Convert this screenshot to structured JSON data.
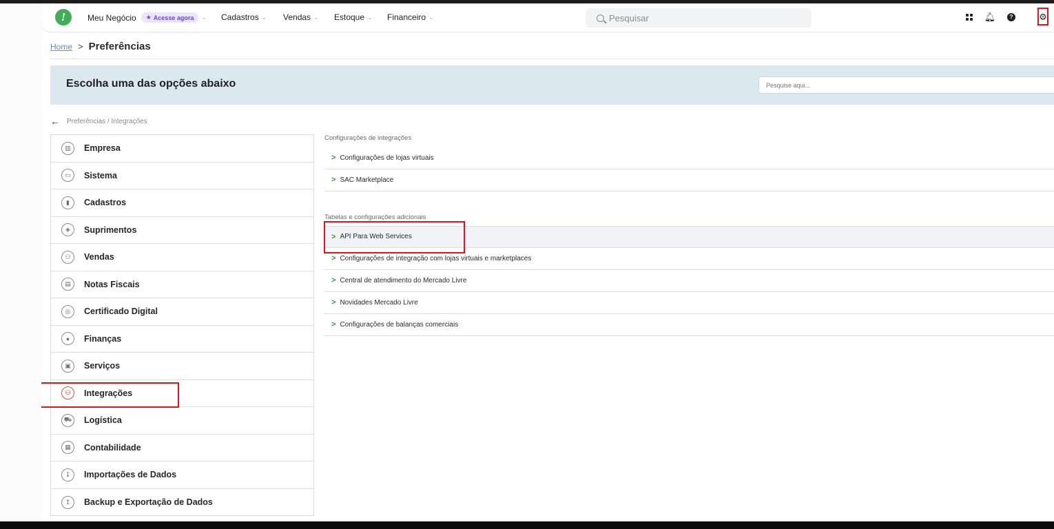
{
  "topnav": {
    "logo_glyph": "!",
    "items": [
      {
        "label": "Meu Negócio",
        "badge": "Acesse agora"
      },
      {
        "label": "Cadastros"
      },
      {
        "label": "Vendas"
      },
      {
        "label": "Estoque"
      },
      {
        "label": "Financeiro"
      }
    ],
    "search_placeholder": "Pesquisar",
    "icons": [
      "apps-icon",
      "bell-icon",
      "help-icon",
      "gear-icon"
    ]
  },
  "breadcrumb": {
    "home": "Home",
    "separator": ">",
    "current": "Preferências"
  },
  "banner": {
    "title": "Escolha uma das opções abaixo",
    "search_placeholder": "Pesquise aqui..."
  },
  "back": {
    "path": "Preferências / Integrações"
  },
  "menu": {
    "items": [
      {
        "label": "Empresa",
        "icon": "building-icon",
        "glyph": "▥"
      },
      {
        "label": "Sistema",
        "icon": "monitor-icon",
        "glyph": "▭"
      },
      {
        "label": "Cadastros",
        "icon": "book-icon",
        "glyph": "▮"
      },
      {
        "label": "Suprimentos",
        "icon": "box-icon",
        "glyph": "◈"
      },
      {
        "label": "Vendas",
        "icon": "people-icon",
        "glyph": "⚇"
      },
      {
        "label": "Notas Fiscais",
        "icon": "invoice-icon",
        "glyph": "▤"
      },
      {
        "label": "Certificado Digital",
        "icon": "certificate-icon",
        "glyph": "◎"
      },
      {
        "label": "Finanças",
        "icon": "piggy-bank-icon",
        "glyph": "●"
      },
      {
        "label": "Serviços",
        "icon": "clipboard-icon",
        "glyph": "▣"
      },
      {
        "label": "Integrações",
        "icon": "integration-icon",
        "glyph": "⛁",
        "active": true
      },
      {
        "label": "Logística",
        "icon": "truck-icon",
        "glyph": "⛟"
      },
      {
        "label": "Contabilidade",
        "icon": "calculator-icon",
        "glyph": "▦"
      },
      {
        "label": "Importações de Dados",
        "icon": "import-icon",
        "glyph": "↧"
      },
      {
        "label": "Backup e Exportação de Dados",
        "icon": "export-icon",
        "glyph": "↥"
      }
    ]
  },
  "sections": {
    "integracoes": {
      "title": "Configurações de integrações",
      "links": [
        "Configurações de lojas virtuais",
        "SAC Marketplace"
      ]
    },
    "tabelas": {
      "title": "Tabelas e configurações adicionais",
      "links": [
        "API Para Web Services",
        "Configurações de integração com lojas virtuais e marketplaces",
        "Central de atendimento do Mercado Livre",
        "Novidades Mercado Livre",
        "Configurações de balanças comerciais"
      ]
    },
    "link_chevron": ">"
  },
  "colors": {
    "brand_green": "#3fae55",
    "badge_purple": "#6a48d9",
    "banner_bg": "#dbe8ef",
    "highlight_red": "#e31414",
    "active_icon": "#e84b3c"
  }
}
